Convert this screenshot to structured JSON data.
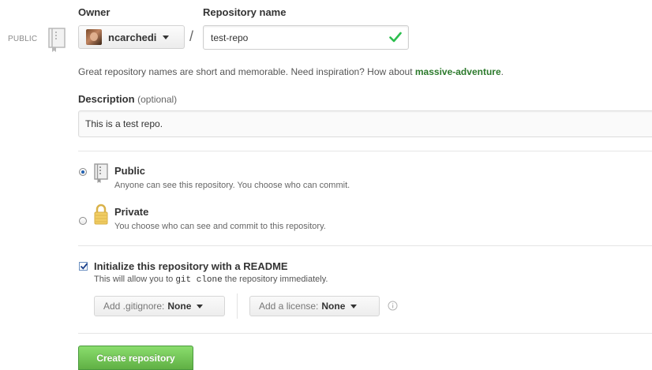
{
  "left_badge": {
    "label": "PUBLIC",
    "icon": "repo-book-icon"
  },
  "owner": {
    "label": "Owner",
    "name": "ncarchedi"
  },
  "repo_name": {
    "label": "Repository name",
    "value": "test-repo",
    "status_icon": "check-icon"
  },
  "separator": "/",
  "hint": {
    "text": "Great repository names are short and memorable. Need inspiration? How about ",
    "suggestion": "massive-adventure",
    "end": "."
  },
  "description": {
    "label": "Description",
    "optional": "(optional)",
    "value": "This is a test repo."
  },
  "visibility": {
    "selected": "public",
    "public": {
      "title": "Public",
      "desc": "Anyone can see this repository. You choose who can commit."
    },
    "private": {
      "title": "Private",
      "desc": "You choose who can see and commit to this repository."
    }
  },
  "readme": {
    "checked": true,
    "title": "Initialize this repository with a README",
    "desc_before": "This will allow you to ",
    "desc_code": "git clone",
    "desc_after": " the repository immediately."
  },
  "gitignore": {
    "label": "Add .gitignore:",
    "value": "None"
  },
  "license": {
    "label": "Add a license:",
    "value": "None"
  },
  "create_button": "Create repository",
  "colors": {
    "suggestion_green": "#2c7a2c",
    "create_button_green": "#60b044",
    "check_green": "#2cbe4e",
    "lock_gold": "#e8c25a"
  }
}
